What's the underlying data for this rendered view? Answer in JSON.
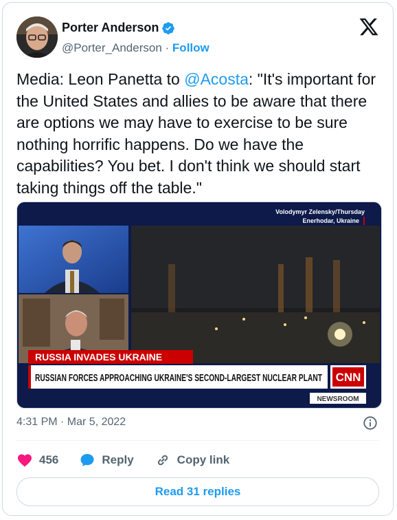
{
  "author": {
    "name": "Porter Anderson",
    "handle": "@Porter_Anderson",
    "separator": "·",
    "follow_label": "Follow"
  },
  "tweet": {
    "prefix": "Media: Leon Panetta to ",
    "mention": "@Acosta",
    "body": ": \"It's important for the United States and allies to be aware that there are options we may have to exercise to be sure nothing horrific happens. Do we have the capabilities? You bet. I don't think we should start taking things off the table.\""
  },
  "media": {
    "source_line1": "Volodymyr Zelensky/Thursday",
    "source_line2": "Enerhodar, Ukraine",
    "banner": "RUSSIA INVADES UKRAINE",
    "headline": "RUSSIAN FORCES APPROACHING UKRAINE'S SECOND-LARGEST NUCLEAR PLANT",
    "network": "CNN",
    "program": "NEWSROOM"
  },
  "timestamp": "4:31 PM · Mar 5, 2022",
  "actions": {
    "like_count": "456",
    "reply_label": "Reply",
    "copy_label": "Copy link"
  },
  "read_replies_label": "Read 31 replies",
  "colors": {
    "accent": "#1d9bf0",
    "like": "#f91880",
    "cnn_red": "#cc0000"
  },
  "icons": [
    "verified-icon",
    "x-logo-icon",
    "info-icon",
    "heart-icon",
    "reply-icon",
    "link-icon"
  ]
}
